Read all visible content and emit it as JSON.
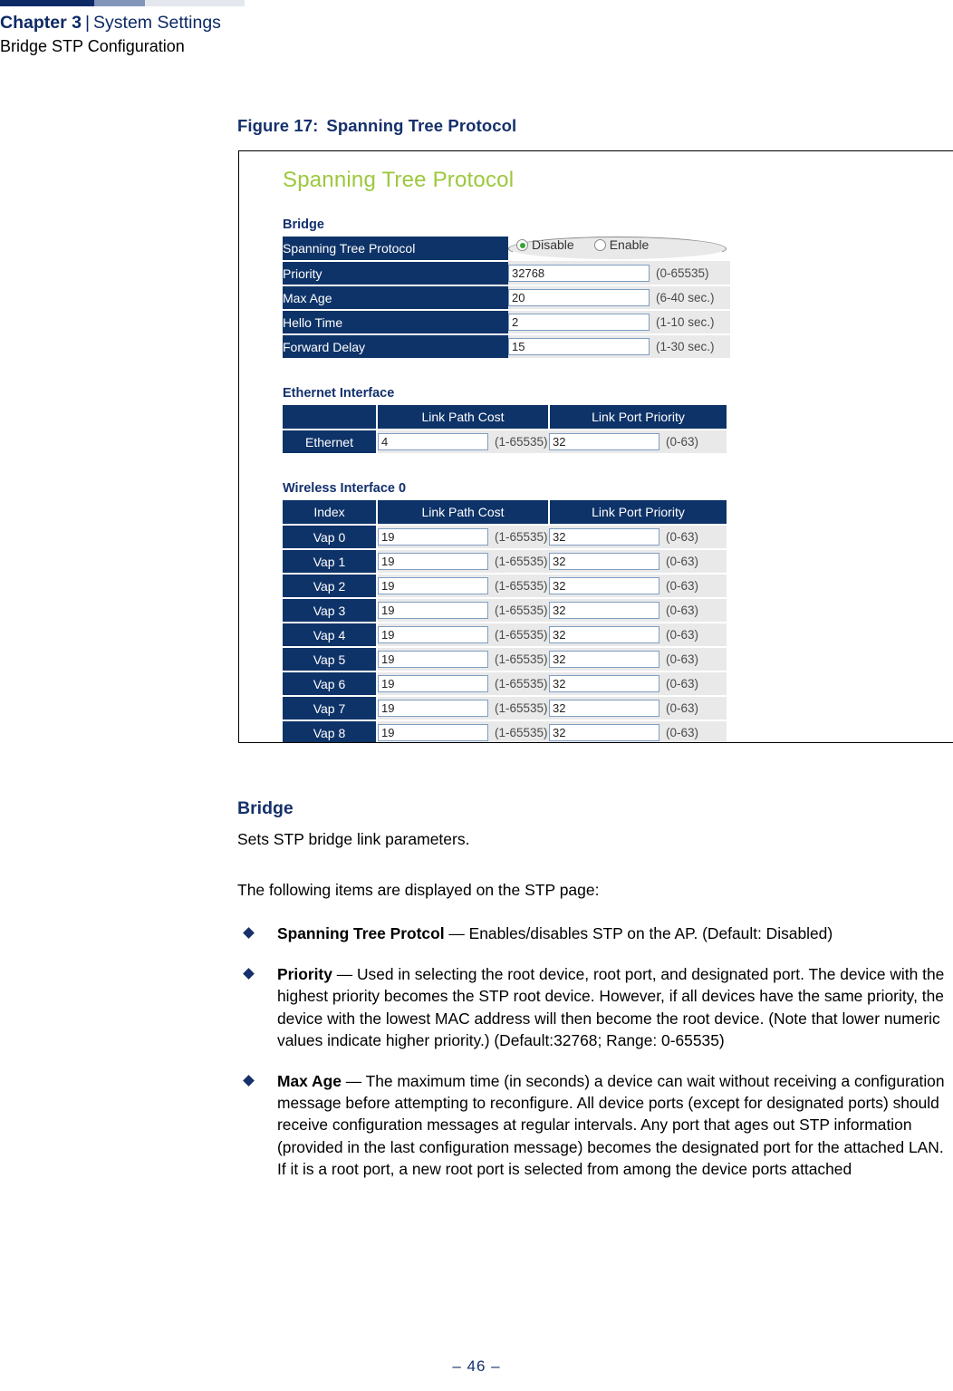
{
  "running_header": {
    "chapter": "Chapter 3",
    "separator": "|",
    "section": "System Settings",
    "subtitle": "Bridge STP Configuration"
  },
  "figure": {
    "label": "Figure 17:",
    "title": "Spanning Tree Protocol"
  },
  "screenshot": {
    "page_title": "Spanning Tree Protocol",
    "bridge": {
      "heading": "Bridge",
      "rows": [
        {
          "label": "Spanning Tree Protocol",
          "type": "radio",
          "options": [
            {
              "label": "Disable",
              "selected": true
            },
            {
              "label": "Enable",
              "selected": false
            }
          ]
        },
        {
          "label": "Priority",
          "type": "text",
          "value": "32768",
          "hint": "(0-65535)"
        },
        {
          "label": "Max Age",
          "type": "text",
          "value": "20",
          "hint": "(6-40 sec.)"
        },
        {
          "label": "Hello Time",
          "type": "text",
          "value": "2",
          "hint": "(1-10 sec.)"
        },
        {
          "label": "Forward Delay",
          "type": "text",
          "value": "15",
          "hint": "(1-30 sec.)"
        }
      ]
    },
    "ethernet": {
      "heading": "Ethernet Interface",
      "columns": {
        "index": "",
        "cost": "Link Path Cost",
        "priority": "Link Port Priority"
      },
      "rows": [
        {
          "index": "Ethernet",
          "cost": "4",
          "cost_hint": "(1-65535)",
          "priority": "32",
          "priority_hint": "(0-63)"
        }
      ]
    },
    "wireless": {
      "heading": "Wireless Interface 0",
      "columns": {
        "index": "Index",
        "cost": "Link Path Cost",
        "priority": "Link Port Priority"
      },
      "rows": [
        {
          "index": "Vap 0",
          "cost": "19",
          "cost_hint": "(1-65535)",
          "priority": "32",
          "priority_hint": "(0-63)"
        },
        {
          "index": "Vap 1",
          "cost": "19",
          "cost_hint": "(1-65535)",
          "priority": "32",
          "priority_hint": "(0-63)"
        },
        {
          "index": "Vap 2",
          "cost": "19",
          "cost_hint": "(1-65535)",
          "priority": "32",
          "priority_hint": "(0-63)"
        },
        {
          "index": "Vap 3",
          "cost": "19",
          "cost_hint": "(1-65535)",
          "priority": "32",
          "priority_hint": "(0-63)"
        },
        {
          "index": "Vap 4",
          "cost": "19",
          "cost_hint": "(1-65535)",
          "priority": "32",
          "priority_hint": "(0-63)"
        },
        {
          "index": "Vap 5",
          "cost": "19",
          "cost_hint": "(1-65535)",
          "priority": "32",
          "priority_hint": "(0-63)"
        },
        {
          "index": "Vap 6",
          "cost": "19",
          "cost_hint": "(1-65535)",
          "priority": "32",
          "priority_hint": "(0-63)"
        },
        {
          "index": "Vap 7",
          "cost": "19",
          "cost_hint": "(1-65535)",
          "priority": "32",
          "priority_hint": "(0-63)"
        },
        {
          "index": "Vap 8",
          "cost": "19",
          "cost_hint": "(1-65535)",
          "priority": "32",
          "priority_hint": "(0-63)"
        }
      ]
    }
  },
  "body": {
    "heading": "Bridge",
    "paragraph_1": "Sets STP bridge link parameters.",
    "paragraph_2": "The following items are displayed on the STP page:",
    "bullets": [
      {
        "term": "Spanning Tree Protcol",
        "text": " — Enables/disables STP on the AP. (Default: Disabled)"
      },
      {
        "term": "Priority",
        "text": " — Used in selecting the root device, root port, and designated port. The device with the highest priority becomes the STP root device. However, if all devices have the same priority, the device with the lowest MAC address will then become the root device. (Note that lower numeric values indicate higher priority.)  (Default:32768; Range: 0-65535)"
      },
      {
        "term": "Max Age",
        "text": " — The maximum time (in seconds) a device can wait without receiving a configuration message before attempting to reconfigure. All device ports (except for designated ports) should receive configuration messages at regular intervals. Any port that ages out STP information (provided in the last configuration message) becomes the designated port for the attached LAN. If it is a root port, a new root port is selected from among the device ports attached"
      }
    ]
  },
  "footer": {
    "page_number": "–  46  –"
  },
  "colors": {
    "navy": "#15306b",
    "table_header": "#0e3368",
    "title_green": "#9cc83c",
    "radio_on": "#2fa72f"
  }
}
